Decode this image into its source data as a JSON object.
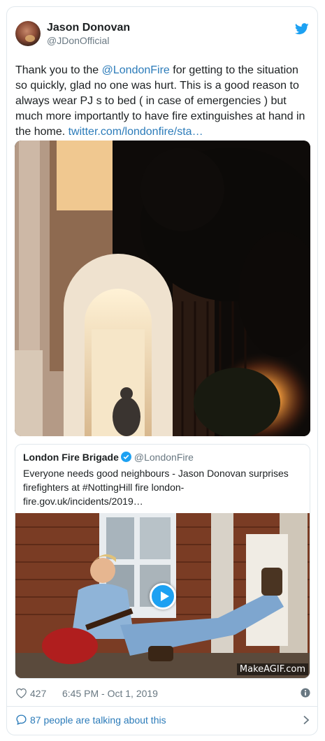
{
  "author": {
    "name": "Jason Donovan",
    "handle": "@JDonOfficial",
    "avatar_icon": "user-avatar"
  },
  "tweet": {
    "text_before": "Thank you to the ",
    "mention": "@LondonFire",
    "text_after": " for getting to the situation so quickly, glad no one was hurt. This is a good reason to always wear PJ s to bed ( in case of emergencies ) but much more importantly to have fire extinguishes at hand in the home. ",
    "link": "twitter.com/londonfire/sta…"
  },
  "quoted": {
    "name": "London Fire Brigade",
    "handle": "@LondonFire",
    "text": "Everyone needs good neighbours - Jason Donovan surprises firefighters at #NottingHill fire london-fire.gov.uk/incidents/2019…",
    "watermark": "MakeAGIF.com"
  },
  "footer": {
    "likes": "427",
    "timestamp": "6:45 PM - Oct 1, 2019",
    "talking": "87 people are talking about this"
  },
  "colors": {
    "link": "#2b7bb9",
    "twitter_blue": "#1da1f2",
    "muted": "#697882",
    "border": "#e1e8ed"
  }
}
